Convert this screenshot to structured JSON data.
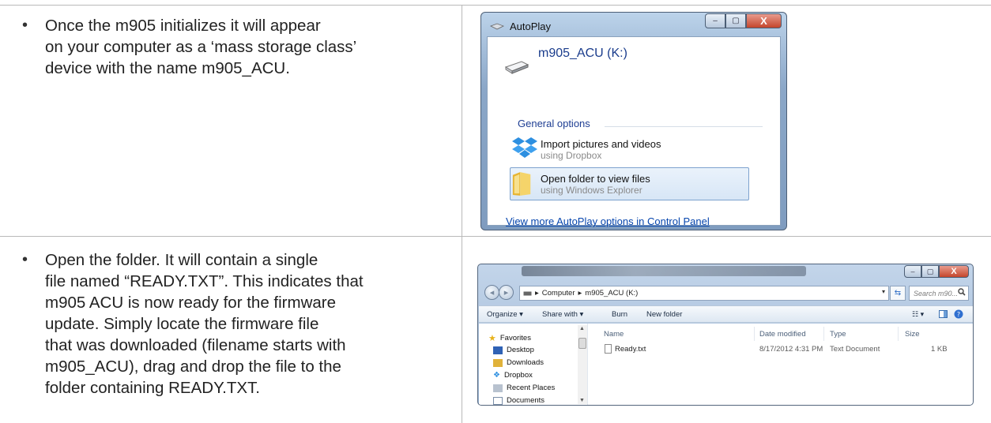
{
  "steps": [
    {
      "bullet": "•",
      "lines": [
        "Once the m905 initializes it will appear",
        "on your computer as a ‘mass storage class’",
        "device with the name m905_ACU."
      ]
    },
    {
      "bullet": "•",
      "lines": [
        "Open the folder.  It will contain a single",
        "file named “READY.TXT”. This indicates that",
        "m905 ACU is now ready for the firmware",
        "update.  Simply locate the firmware file",
        "that was downloaded (filename starts with",
        "m905_ACU), drag and drop the file to the",
        "folder containing READY.TXT."
      ]
    }
  ],
  "autoplay": {
    "title": "AutoPlay",
    "drive_name": "m905_ACU (K:)",
    "group_label": "General options",
    "options": [
      {
        "title": "Import pictures and videos",
        "subtitle": "using Dropbox",
        "icon": "dropbox-icon"
      },
      {
        "title": "Open folder to view files",
        "subtitle": "using Windows Explorer",
        "icon": "folder-icon"
      }
    ],
    "link": "View more AutoPlay options in Control Panel",
    "controls": {
      "minimize": "–",
      "maximize": "▢",
      "close": "X"
    }
  },
  "explorer": {
    "address": {
      "root": "Computer",
      "folder": "m905_ACU (K:)",
      "sep": "▸"
    },
    "search_placeholder": "Search m90...",
    "toolbar": {
      "organize": "Organize ▾",
      "share": "Share with ▾",
      "burn": "Burn",
      "new_folder": "New folder"
    },
    "sidebar": [
      "Favorites",
      "Desktop",
      "Downloads",
      "Dropbox",
      "Recent Places",
      "Documents"
    ],
    "columns": {
      "name": "Name",
      "date": "Date modified",
      "type": "Type",
      "size": "Size"
    },
    "files": [
      {
        "name": "Ready.txt",
        "date": "8/17/2012 4:31 PM",
        "type": "Text Document",
        "size": "1 KB"
      }
    ],
    "controls": {
      "minimize": "–",
      "maximize": "▢",
      "close": "X"
    }
  }
}
